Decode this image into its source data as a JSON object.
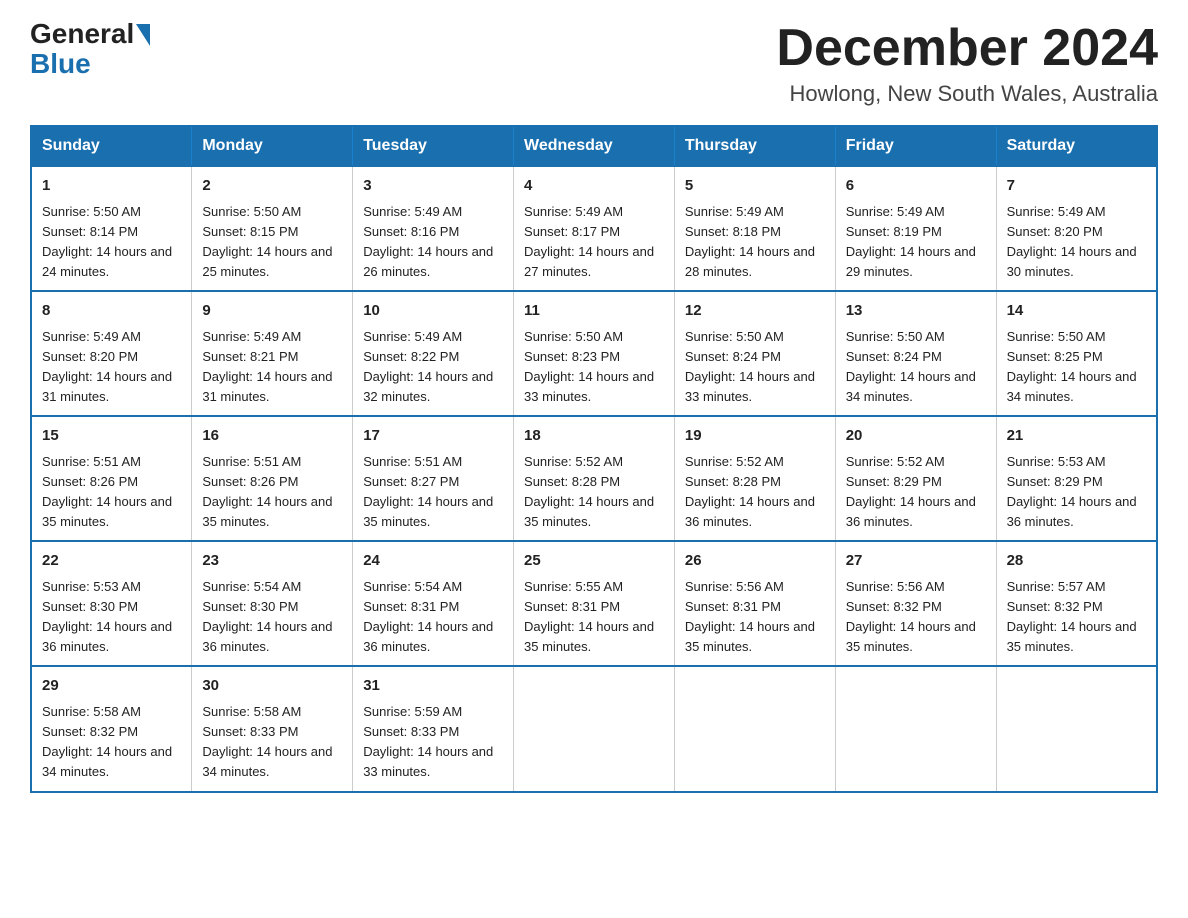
{
  "header": {
    "logo_general": "General",
    "logo_blue": "Blue",
    "month_title": "December 2024",
    "location": "Howlong, New South Wales, Australia"
  },
  "calendar": {
    "days_of_week": [
      "Sunday",
      "Monday",
      "Tuesday",
      "Wednesday",
      "Thursday",
      "Friday",
      "Saturday"
    ],
    "weeks": [
      [
        {
          "day": "1",
          "sunrise": "5:50 AM",
          "sunset": "8:14 PM",
          "daylight": "14 hours and 24 minutes."
        },
        {
          "day": "2",
          "sunrise": "5:50 AM",
          "sunset": "8:15 PM",
          "daylight": "14 hours and 25 minutes."
        },
        {
          "day": "3",
          "sunrise": "5:49 AM",
          "sunset": "8:16 PM",
          "daylight": "14 hours and 26 minutes."
        },
        {
          "day": "4",
          "sunrise": "5:49 AM",
          "sunset": "8:17 PM",
          "daylight": "14 hours and 27 minutes."
        },
        {
          "day": "5",
          "sunrise": "5:49 AM",
          "sunset": "8:18 PM",
          "daylight": "14 hours and 28 minutes."
        },
        {
          "day": "6",
          "sunrise": "5:49 AM",
          "sunset": "8:19 PM",
          "daylight": "14 hours and 29 minutes."
        },
        {
          "day": "7",
          "sunrise": "5:49 AM",
          "sunset": "8:20 PM",
          "daylight": "14 hours and 30 minutes."
        }
      ],
      [
        {
          "day": "8",
          "sunrise": "5:49 AM",
          "sunset": "8:20 PM",
          "daylight": "14 hours and 31 minutes."
        },
        {
          "day": "9",
          "sunrise": "5:49 AM",
          "sunset": "8:21 PM",
          "daylight": "14 hours and 31 minutes."
        },
        {
          "day": "10",
          "sunrise": "5:49 AM",
          "sunset": "8:22 PM",
          "daylight": "14 hours and 32 minutes."
        },
        {
          "day": "11",
          "sunrise": "5:50 AM",
          "sunset": "8:23 PM",
          "daylight": "14 hours and 33 minutes."
        },
        {
          "day": "12",
          "sunrise": "5:50 AM",
          "sunset": "8:24 PM",
          "daylight": "14 hours and 33 minutes."
        },
        {
          "day": "13",
          "sunrise": "5:50 AM",
          "sunset": "8:24 PM",
          "daylight": "14 hours and 34 minutes."
        },
        {
          "day": "14",
          "sunrise": "5:50 AM",
          "sunset": "8:25 PM",
          "daylight": "14 hours and 34 minutes."
        }
      ],
      [
        {
          "day": "15",
          "sunrise": "5:51 AM",
          "sunset": "8:26 PM",
          "daylight": "14 hours and 35 minutes."
        },
        {
          "day": "16",
          "sunrise": "5:51 AM",
          "sunset": "8:26 PM",
          "daylight": "14 hours and 35 minutes."
        },
        {
          "day": "17",
          "sunrise": "5:51 AM",
          "sunset": "8:27 PM",
          "daylight": "14 hours and 35 minutes."
        },
        {
          "day": "18",
          "sunrise": "5:52 AM",
          "sunset": "8:28 PM",
          "daylight": "14 hours and 35 minutes."
        },
        {
          "day": "19",
          "sunrise": "5:52 AM",
          "sunset": "8:28 PM",
          "daylight": "14 hours and 36 minutes."
        },
        {
          "day": "20",
          "sunrise": "5:52 AM",
          "sunset": "8:29 PM",
          "daylight": "14 hours and 36 minutes."
        },
        {
          "day": "21",
          "sunrise": "5:53 AM",
          "sunset": "8:29 PM",
          "daylight": "14 hours and 36 minutes."
        }
      ],
      [
        {
          "day": "22",
          "sunrise": "5:53 AM",
          "sunset": "8:30 PM",
          "daylight": "14 hours and 36 minutes."
        },
        {
          "day": "23",
          "sunrise": "5:54 AM",
          "sunset": "8:30 PM",
          "daylight": "14 hours and 36 minutes."
        },
        {
          "day": "24",
          "sunrise": "5:54 AM",
          "sunset": "8:31 PM",
          "daylight": "14 hours and 36 minutes."
        },
        {
          "day": "25",
          "sunrise": "5:55 AM",
          "sunset": "8:31 PM",
          "daylight": "14 hours and 35 minutes."
        },
        {
          "day": "26",
          "sunrise": "5:56 AM",
          "sunset": "8:31 PM",
          "daylight": "14 hours and 35 minutes."
        },
        {
          "day": "27",
          "sunrise": "5:56 AM",
          "sunset": "8:32 PM",
          "daylight": "14 hours and 35 minutes."
        },
        {
          "day": "28",
          "sunrise": "5:57 AM",
          "sunset": "8:32 PM",
          "daylight": "14 hours and 35 minutes."
        }
      ],
      [
        {
          "day": "29",
          "sunrise": "5:58 AM",
          "sunset": "8:32 PM",
          "daylight": "14 hours and 34 minutes."
        },
        {
          "day": "30",
          "sunrise": "5:58 AM",
          "sunset": "8:33 PM",
          "daylight": "14 hours and 34 minutes."
        },
        {
          "day": "31",
          "sunrise": "5:59 AM",
          "sunset": "8:33 PM",
          "daylight": "14 hours and 33 minutes."
        },
        null,
        null,
        null,
        null
      ]
    ]
  }
}
